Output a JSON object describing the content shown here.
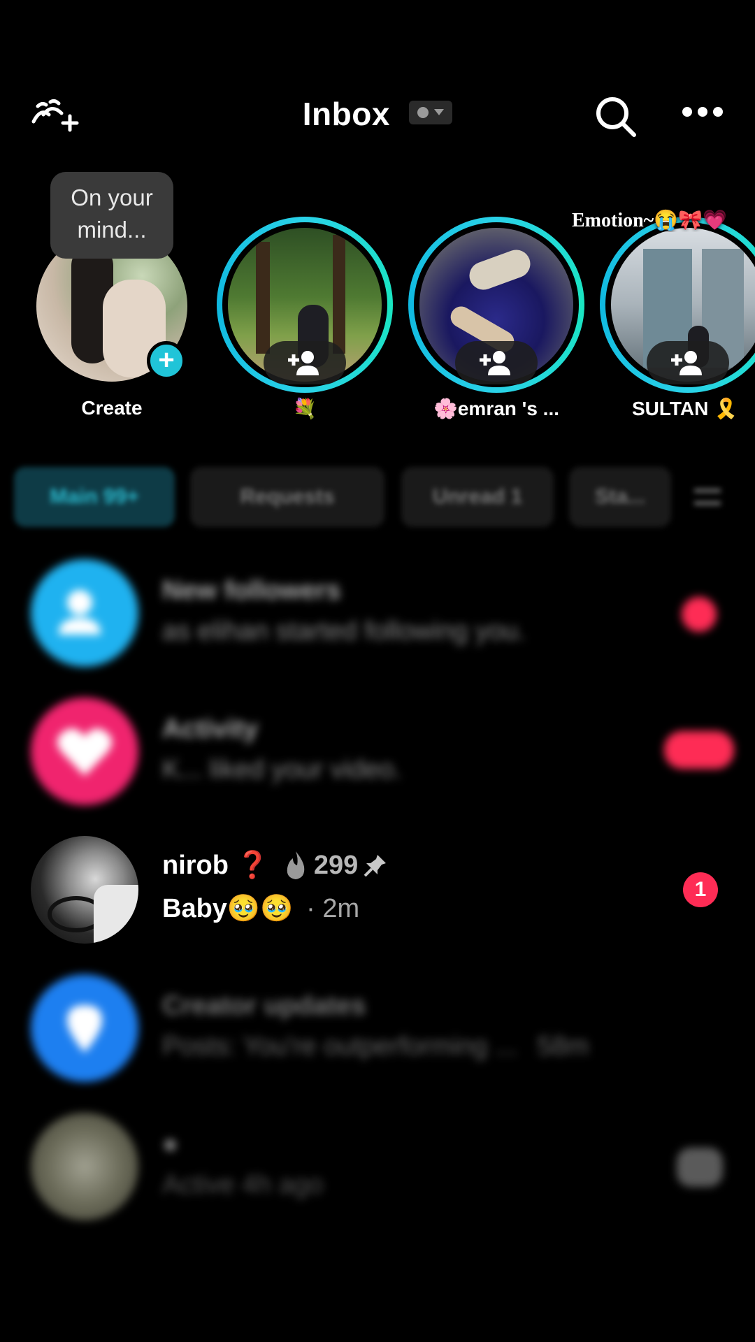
{
  "header": {
    "title": "Inbox",
    "add_friends_icon": "add-people-icon",
    "search_icon": "search-icon",
    "more_icon": "more-horizontal-icon"
  },
  "stories": {
    "create": {
      "bubble_text": "On your mind...",
      "label": "Create"
    },
    "items": [
      {
        "label": "💐",
        "caption": ""
      },
      {
        "label": "🌸emran 's ...",
        "caption": ""
      },
      {
        "label": "SULTAN 🎗️",
        "caption": "Emotion~😭🎀💗"
      }
    ]
  },
  "filters": [
    "Main 99+",
    "Requests",
    "Unread 1",
    "Sta..."
  ],
  "messages": [
    {
      "title": "New followers",
      "subtitle": "as elihan started following you."
    },
    {
      "title": "Activity",
      "subtitle": "K... liked your video."
    },
    {
      "name": "nirob ❓",
      "streak": "299",
      "last_message": "Baby🥹🥹",
      "time": "· 2m",
      "unread": "1"
    },
    {
      "title": "Creator updates",
      "subtitle": "Posts: You're outperforming ...",
      "time": "58m"
    },
    {
      "title": "●",
      "subtitle": "Active 4h ago"
    }
  ],
  "colors": {
    "accent_teal": "#20c4d8",
    "badge_red": "#fe2c55",
    "followers_blue": "#1fb2f0",
    "activity_pink": "#f0246e",
    "creator_blue": "#1d7ff0"
  }
}
